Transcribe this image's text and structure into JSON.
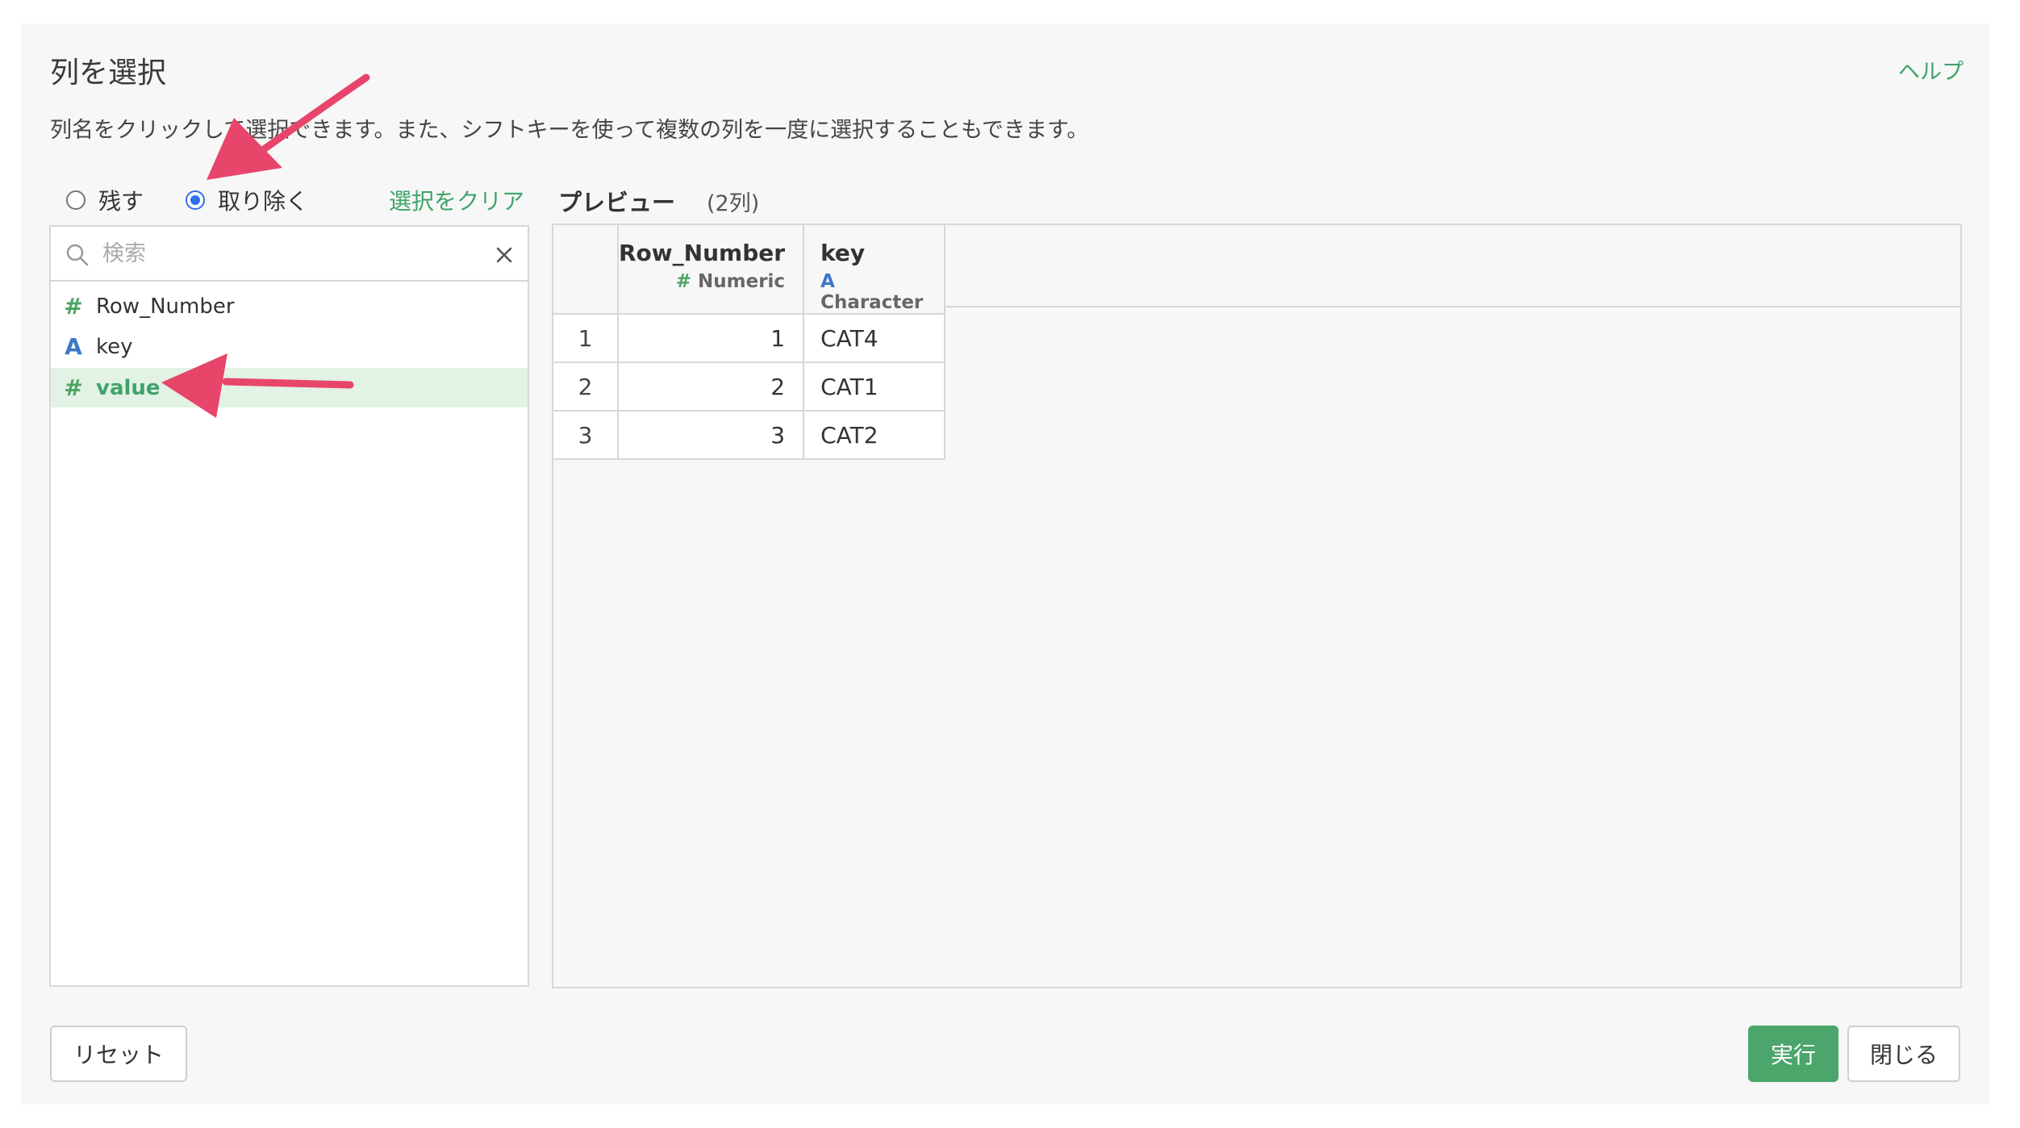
{
  "dialog": {
    "title": "列を選択",
    "help_label": "ヘルプ",
    "description": "列名をクリックして選択できます。また、シフトキーを使って複数の列を一度に選択することもできます。"
  },
  "mode": {
    "keep_label": "残す",
    "remove_label": "取り除く",
    "selected": "remove",
    "clear_label": "選択をクリア"
  },
  "search": {
    "placeholder": "検索",
    "value": ""
  },
  "columns": [
    {
      "name": "Row_Number",
      "type_icon": "#",
      "selected": false
    },
    {
      "name": "key",
      "type_icon": "A",
      "selected": false
    },
    {
      "name": "value",
      "type_icon": "#",
      "selected": true
    }
  ],
  "preview": {
    "title": "プレビュー",
    "count": "(2列)",
    "headers": [
      {
        "name": "Row_Number",
        "type_icon": "#",
        "type": "Numeric"
      },
      {
        "name": "key",
        "type_icon": "A",
        "type": "Character"
      }
    ],
    "rows": [
      {
        "index": "1",
        "row_number": "1",
        "key": "CAT4"
      },
      {
        "index": "2",
        "row_number": "2",
        "key": "CAT1"
      },
      {
        "index": "3",
        "row_number": "3",
        "key": "CAT2"
      }
    ]
  },
  "buttons": {
    "reset": "リセット",
    "run": "実行",
    "close": "閉じる"
  },
  "colors": {
    "accent_green": "#4ca56a",
    "annotation_pink": "#e8456b",
    "radio_blue": "#2f6fe8"
  },
  "annotations": [
    "arrow-pointing-remove-radio",
    "arrow-pointing-value-column"
  ]
}
